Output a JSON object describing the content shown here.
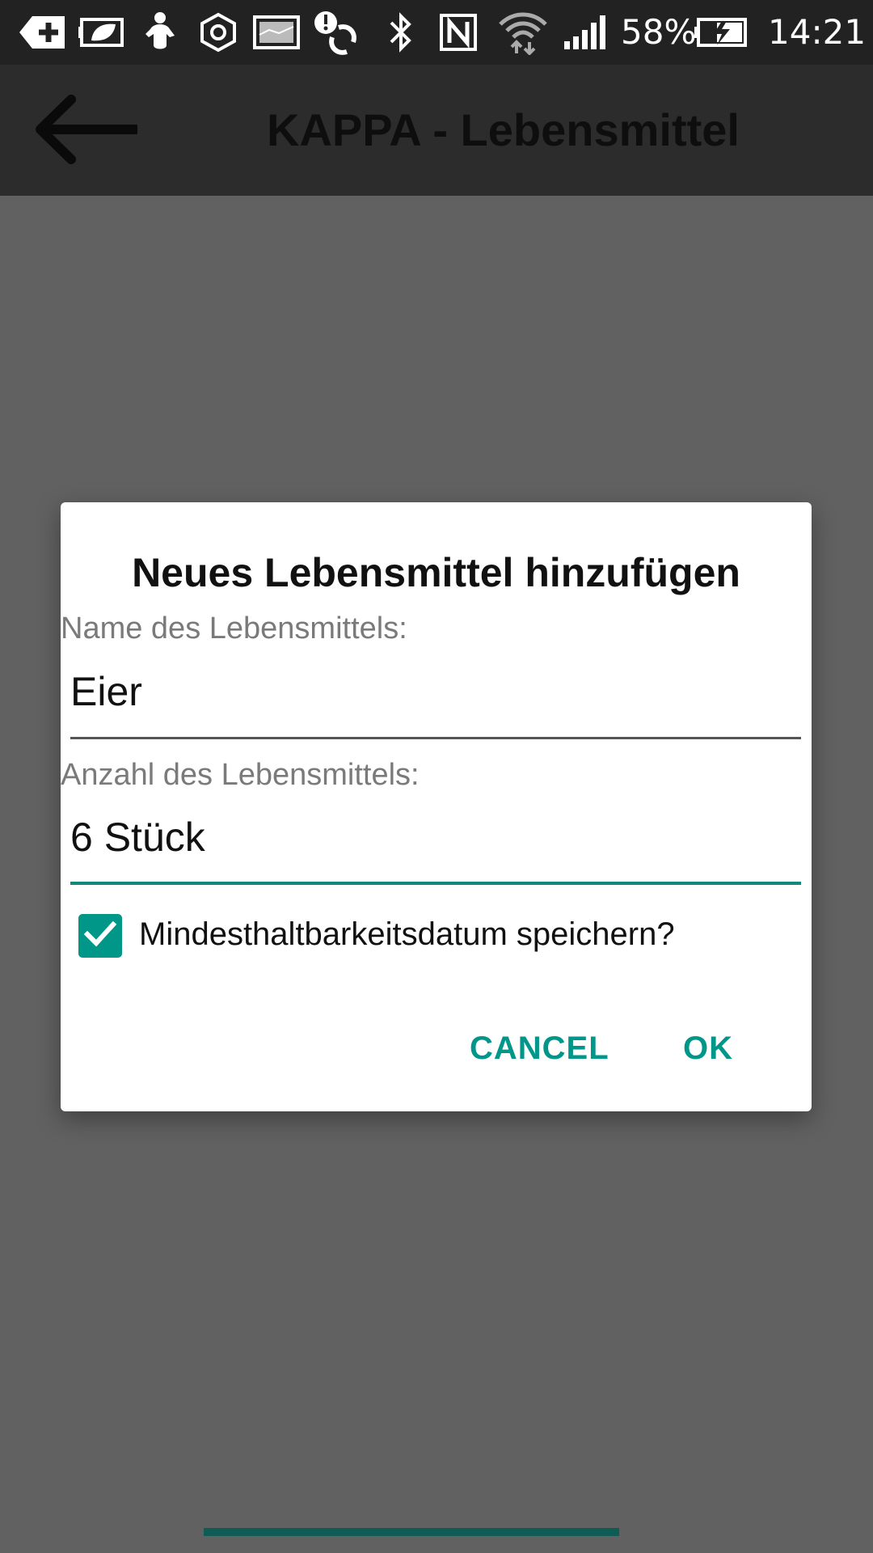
{
  "status_bar": {
    "icons": [
      "download-icon",
      "battery-saver-icon",
      "baby-icon",
      "hexagon-icon",
      "gallery-icon",
      "sync-alert-icon",
      "bluetooth-icon",
      "nfc-icon",
      "wifi-icon",
      "signal-icon"
    ],
    "battery_percent": "58%",
    "time": "14:21"
  },
  "app_bar": {
    "back_icon": "arrow-left-icon",
    "title": "KAPPA - Lebensmittel"
  },
  "dialog": {
    "title": "Neues Lebensmittel hinzufügen",
    "name_label": "Name des Lebensmittels:",
    "name_value": "Eier",
    "quantity_label": "Anzahl des Lebensmittels:",
    "quantity_value": "6 Stück",
    "checkbox_label": "Mindesthaltbarkeitsdatum speichern?",
    "checkbox_checked": true,
    "cancel_label": "CANCEL",
    "ok_label": "OK"
  },
  "colors": {
    "accent": "#009688",
    "status_bar": "#222222",
    "app_bar": "#2c2c2c",
    "scrim": "#616161"
  }
}
